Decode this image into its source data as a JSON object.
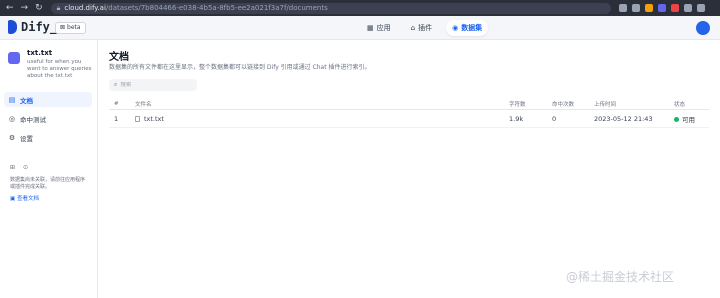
{
  "browser": {
    "url_host": "cloud.dify.ai",
    "url_path": "/datasets/7b804466-e038-4b5a-8fb5-ee2a021f3a7f/documents"
  },
  "header": {
    "logo_text": "Dify_",
    "beta_label": "beta",
    "nav": [
      {
        "icon": "grid-icon",
        "glyph": "▦",
        "label": "应用"
      },
      {
        "icon": "puzzle-icon",
        "glyph": "⌂",
        "label": "插件"
      },
      {
        "icon": "database-icon",
        "glyph": "◉",
        "label": "数据集"
      }
    ],
    "accent_color": "#1c64f2"
  },
  "sidebar": {
    "dataset_name": "txt.txt",
    "dataset_desc": "useful for when you want to answer queries about the txt.txt",
    "items": [
      {
        "icon": "document-icon",
        "glyph": "▤",
        "label": "文档"
      },
      {
        "icon": "target-icon",
        "glyph": "◎",
        "label": "命中测试"
      },
      {
        "icon": "gear-icon",
        "glyph": "⚙",
        "label": "设置"
      }
    ],
    "tools": [
      {
        "icon": "api-icon",
        "glyph": "⊞"
      },
      {
        "icon": "link-icon",
        "glyph": "⊙"
      }
    ],
    "note": "数据集尚未关联，请前往应用程序或插件完成关联。",
    "link": "查看文档"
  },
  "main": {
    "title": "文档",
    "description": "数据集的所有文件都在这里显示，整个数据集都可以链接到 Dify 引用或通过 Chat 插件进行索引。",
    "search_placeholder": "搜索",
    "columns": {
      "idx": "#",
      "name": "文件名",
      "words": "字符数",
      "hits": "命中次数",
      "time": "上传时间",
      "status": "状态"
    },
    "rows": [
      {
        "idx": "1",
        "name": "txt.txt",
        "words": "1.9k",
        "hits": "0",
        "time": "2023-05-12 21:43",
        "status": "可用",
        "status_color": "#12b76a"
      }
    ]
  },
  "watermark": "@稀土掘金技术社区"
}
